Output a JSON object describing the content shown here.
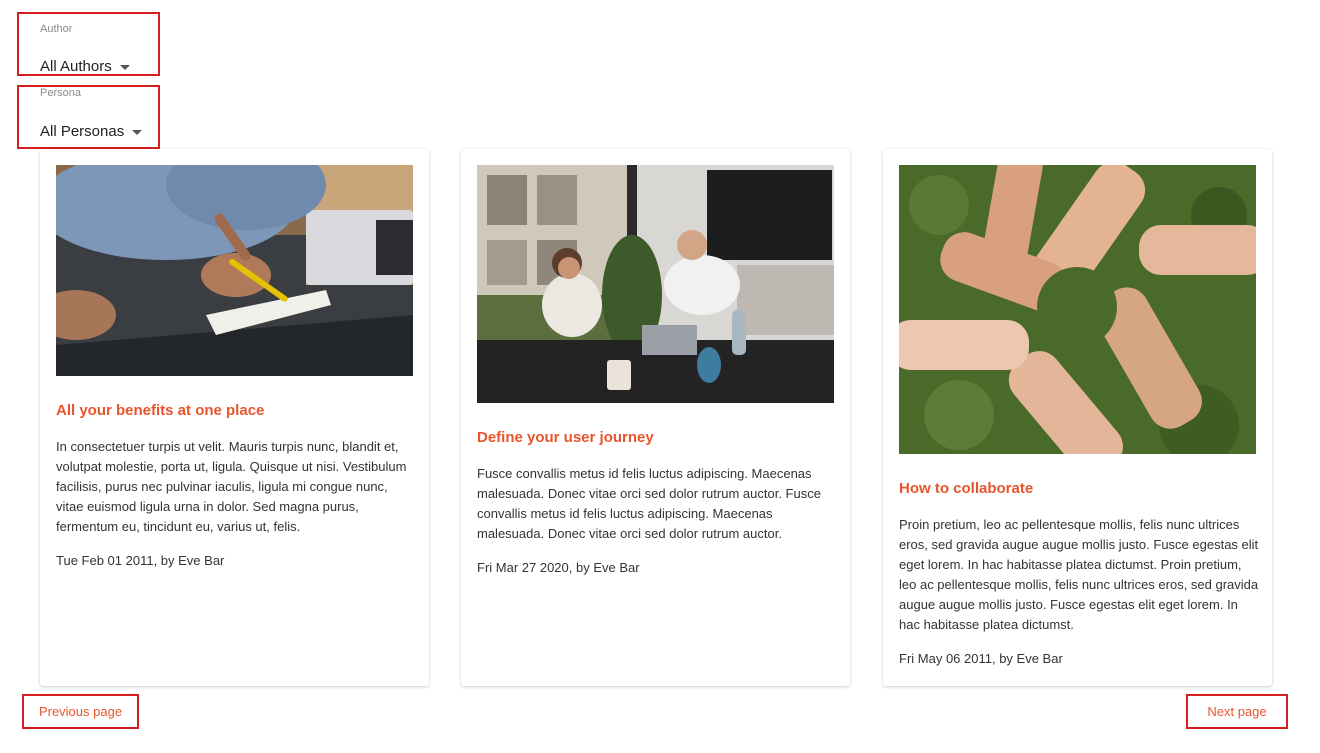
{
  "filters": {
    "author": {
      "label": "Author",
      "value": "All Authors"
    },
    "persona": {
      "label": "Persona",
      "value": "All Personas"
    }
  },
  "posts": [
    {
      "title": "All your benefits at one place",
      "body": "In consectetuer turpis ut velit. Mauris turpis nunc, blandit et, volutpat molestie, porta ut, ligula. Quisque ut nisi. Vestibulum facilisis, purus nec pulvinar iaculis, ligula mi congue nunc, vitae euismod ligula urna in dolor. Sed magna purus, fermentum eu, tincidunt eu, varius ut, felis.",
      "meta": "Tue Feb 01 2011, by Eve Bar",
      "image": "person-writing-at-desk-photo"
    },
    {
      "title": "Define your user journey",
      "body": "Fusce convallis metus id felis luctus adipiscing. Maecenas malesuada. Donec vitae orci sed dolor rutrum auctor. Fusce convallis metus id felis luctus adipiscing. Maecenas malesuada. Donec vitae orci sed dolor rutrum auctor.",
      "meta": "Fri Mar 27 2020, by Eve Bar",
      "image": "office-meeting-photo"
    },
    {
      "title": "How to collaborate",
      "body": "Proin pretium, leo ac pellentesque mollis, felis nunc ultrices eros, sed gravida augue augue mollis justo. Fusce egestas elit eget lorem. In hac habitasse platea dictumst. Proin pretium, leo ac pellentesque mollis, felis nunc ultrices eros, sed gravida augue augue mollis justo. Fusce egestas elit eget lorem. In hac habitasse platea dictumst.",
      "meta": "Fri May 06 2011, by Eve Bar",
      "image": "joined-hands-circle-photo"
    }
  ],
  "pagination": {
    "previous": "Previous page",
    "next": "Next page"
  },
  "colors": {
    "accent": "#e8552d",
    "highlight_border": "#d71e1e"
  }
}
